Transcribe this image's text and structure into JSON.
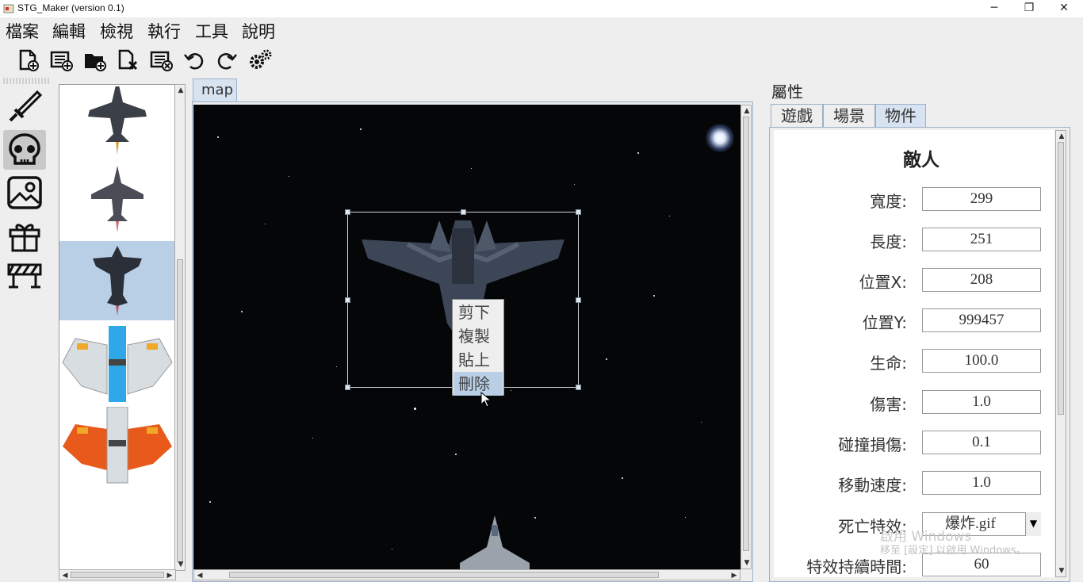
{
  "window": {
    "title": "STG_Maker (version 0.1)",
    "min": "─",
    "restore": "❐",
    "close": "✕"
  },
  "menu": [
    "檔案",
    "編輯",
    "檢視",
    "執行",
    "工具",
    "說明"
  ],
  "toolbar_icons": [
    "new-file-icon",
    "new-list-icon",
    "new-folder-icon",
    "close-file-icon",
    "delete-list-icon",
    "undo-icon",
    "redo-icon",
    "settings-icon"
  ],
  "categories": [
    {
      "icon": "sword-icon",
      "active": false
    },
    {
      "icon": "skull-icon",
      "active": true
    },
    {
      "icon": "image-icon",
      "active": false
    },
    {
      "icon": "gift-icon",
      "active": false
    },
    {
      "icon": "barrier-icon",
      "active": false
    }
  ],
  "map_tab": "map",
  "context_menu": [
    "剪下",
    "複製",
    "貼上",
    "刪除"
  ],
  "props": {
    "title": "屬性",
    "tabs": [
      "遊戲",
      "場景",
      "物件"
    ],
    "active_tab": 2,
    "entity_title": "敵人",
    "fields": [
      {
        "label": "寬度:",
        "value": "299"
      },
      {
        "label": "長度:",
        "value": "251"
      },
      {
        "label": "位置X:",
        "value": "208"
      },
      {
        "label": "位置Y:",
        "value": "999457"
      },
      {
        "label": "生命:",
        "value": "100.0"
      },
      {
        "label": "傷害:",
        "value": "1.0"
      },
      {
        "label": "碰撞損傷:",
        "value": "0.1"
      },
      {
        "label": "移動速度:",
        "value": "1.0"
      },
      {
        "label": "死亡特效:",
        "value": "爆炸.gif"
      },
      {
        "label": "特效持續時間:",
        "value": "60"
      }
    ]
  },
  "watermark": {
    "line1": "啟用 Windows",
    "line2": "移至 [設定] 以啟用 Windows。"
  }
}
